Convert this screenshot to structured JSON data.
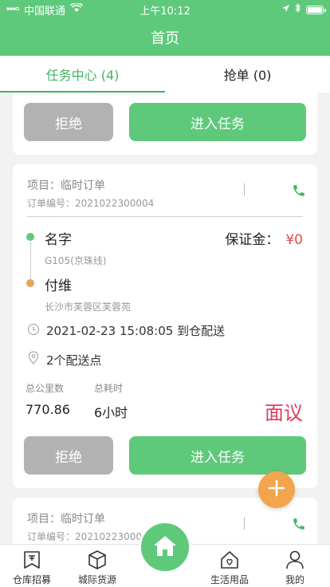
{
  "status_bar": {
    "carrier": "中国联通",
    "time": "上午10:12"
  },
  "nav": {
    "title": "首页"
  },
  "tabs": [
    {
      "label": "任务中心 (4)",
      "active": true
    },
    {
      "label": "抢单 (0)",
      "active": false
    }
  ],
  "top_card": {
    "reject_label": "拒绝",
    "enter_label": "进入任务"
  },
  "task": {
    "project": "项目：临时订单",
    "order_no": "订单编号：2021022300004",
    "origin": "名字",
    "origin_sub": "G105(京珠线)",
    "destination": "付维",
    "destination_sub": "长沙市芙蓉区芙蓉苑",
    "deposit_label": "保证金：",
    "deposit_amount": "¥0",
    "time_text": "2021-02-23 15:08:05 到仓配送",
    "points_text": "2个配送点",
    "distance_label": "总公里数",
    "distance_value": "770.86",
    "duration_label": "总耗时",
    "duration_value": "6小时",
    "price": "面议",
    "reject_label": "拒绝",
    "enter_label": "进入任务"
  },
  "next_task": {
    "project": "项目：临时订单",
    "order_no": "订单编号：20210223000"
  },
  "bottom_nav": [
    {
      "label": "仓库招募",
      "icon": "warehouse-icon"
    },
    {
      "label": "城际货源",
      "icon": "cube-icon"
    },
    {
      "label": "生活用品",
      "icon": "home-heart-icon"
    },
    {
      "label": "我的",
      "icon": "user-icon"
    }
  ],
  "colors": {
    "primary": "#5ec97a",
    "accent_orange": "#f3a54d",
    "price_red": "#e03b5d",
    "deposit_red": "#e24a4a"
  }
}
